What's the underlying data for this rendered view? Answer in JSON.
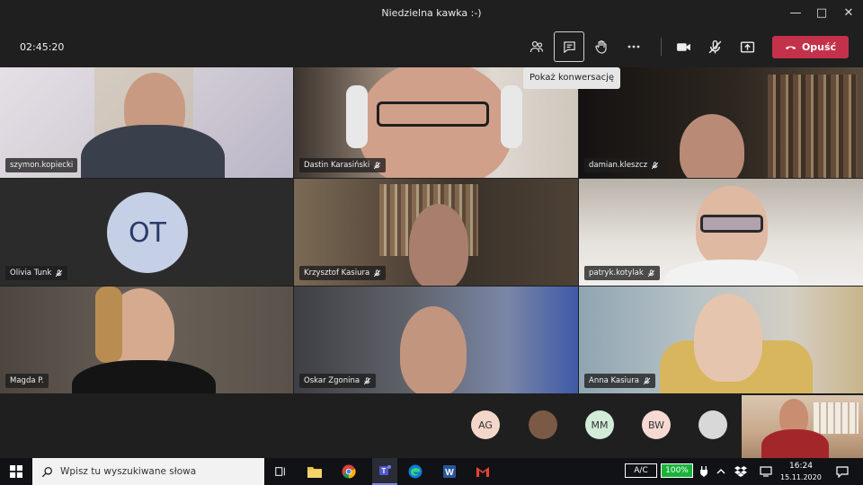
{
  "window": {
    "title": "Niedzielna kawka :-)"
  },
  "toolbar": {
    "timer": "02:45:20",
    "leave_label": "Opuść",
    "tooltip": "Pokaż konwersację",
    "colors": {
      "leave": "#c4314b"
    }
  },
  "participants": [
    {
      "name": "szymon.kopiecki",
      "muted": false
    },
    {
      "name": "Dastin Karasiński",
      "muted": true
    },
    {
      "name": "damian.kleszcz",
      "muted": true
    },
    {
      "name": "Olivia Tunk",
      "initials": "OT",
      "muted": true
    },
    {
      "name": "Krzysztof Kasiura",
      "muted": true
    },
    {
      "name": "patryk.kotylak",
      "muted": true
    },
    {
      "name": "Magda P.",
      "muted": false
    },
    {
      "name": "Oskar Zgonina",
      "muted": true
    },
    {
      "name": "Anna Kasiura",
      "muted": true
    }
  ],
  "overflow": [
    {
      "initials": "AG",
      "color": "#f3d7c9"
    },
    {
      "initials": "",
      "color": "#7a5a44"
    },
    {
      "initials": "MM",
      "color": "#d2ecd9"
    },
    {
      "initials": "BW",
      "color": "#f6d9d2"
    },
    {
      "initials": "",
      "color": "#d8d8d8"
    }
  ],
  "taskbar": {
    "search_placeholder": "Wpisz tu wyszukiwane słowa",
    "ac_label": "A/C",
    "battery": "100%",
    "time": "16:24",
    "date": "15.11.2020"
  }
}
